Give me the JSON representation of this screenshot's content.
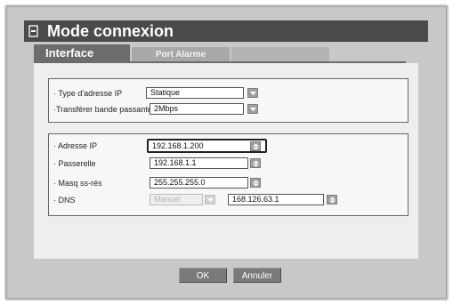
{
  "window": {
    "title": "Mode connexion"
  },
  "tabs": [
    {
      "label": "Interface"
    },
    {
      "label": "Port Alarme"
    }
  ],
  "ip_type": {
    "label": "Type d'adresse IP",
    "value": "Statique"
  },
  "bandwidth": {
    "label": "Transférer bande passante",
    "value": "2Mbps"
  },
  "ip_address": {
    "label": "Adresse IP",
    "value": "192.168.1.200"
  },
  "gateway": {
    "label": "Passerelle",
    "value": "192.168.1.1"
  },
  "subnet": {
    "label": "Masq ss-rés",
    "value": "255.255.255.0"
  },
  "dns": {
    "label": "DNS",
    "mode": "Manuel",
    "value": "168.126.63.1"
  },
  "buttons": {
    "ok": "OK",
    "cancel": "Annuler"
  }
}
